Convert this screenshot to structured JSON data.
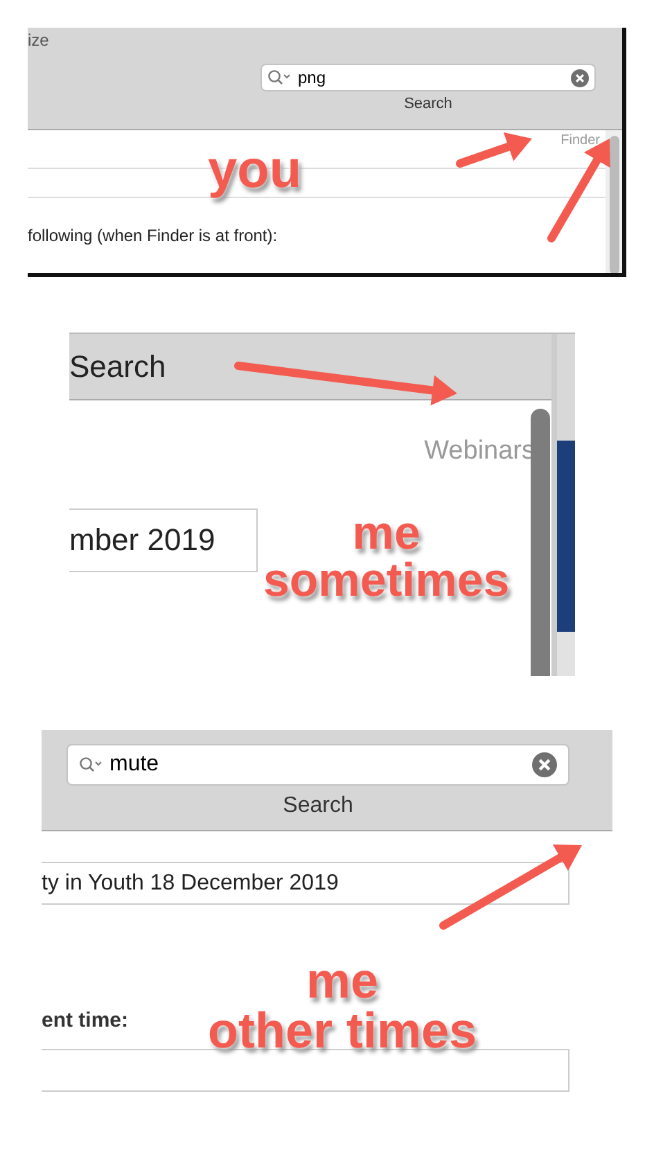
{
  "screenshots": [
    {
      "kind": "finder",
      "top_label": "ize",
      "search": {
        "value": "png"
      },
      "search_caption": "Search",
      "corner_label": "Finder",
      "description": "following (when Finder is at front):"
    },
    {
      "kind": "webinars",
      "toolbar_title": "Search",
      "corner_label": "Webinars",
      "field": {
        "value": "mber 2019"
      }
    },
    {
      "kind": "search",
      "search": {
        "value": "mute"
      },
      "search_caption": "Search",
      "field": {
        "value": "ty in Youth 18 December 2019"
      },
      "field_label": "ent time:"
    }
  ],
  "annotations": [
    {
      "lines": [
        "you"
      ]
    },
    {
      "lines": [
        "me",
        "sometimes"
      ]
    },
    {
      "lines": [
        "me",
        "other times"
      ]
    }
  ]
}
